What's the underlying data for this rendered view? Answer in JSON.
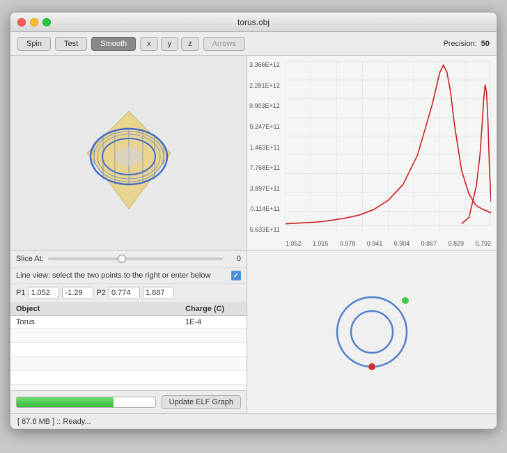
{
  "window": {
    "title": "torus.obj"
  },
  "toolbar": {
    "spin_label": "Spin",
    "test_label": "Test",
    "smooth_label": "Smooth",
    "x_label": "x",
    "y_label": "y",
    "z_label": "z",
    "arrows_label": "Arrows",
    "precision_label": "Precision:",
    "precision_value": "50"
  },
  "slice": {
    "label": "Slice At:",
    "value": "0"
  },
  "line_view": {
    "text": "Line view: select the two points to the right or enter below"
  },
  "points": {
    "p1_label": "P1",
    "p1_x": "1.052",
    "p1_y": "-1.29",
    "p2_label": "P2",
    "p2_x": "0.774",
    "p2_y": "1.687"
  },
  "table": {
    "headers": [
      "Object",
      "Charge (C)"
    ],
    "rows": [
      {
        "object": "Torus",
        "charge": "1E-4"
      }
    ]
  },
  "update_button": {
    "label": "Update ELF Graph"
  },
  "status": {
    "text": "[ 87.8 MB ] :: Ready..."
  },
  "chart": {
    "y_labels": [
      "3.366E+12",
      "2.281E+12",
      "9.903E+12",
      "5.247E+11",
      "1.463E+11",
      "7.768E+11",
      "3.897E+11",
      "0.114E+11",
      "5.633E+11"
    ],
    "x_labels": [
      "1.052",
      "1.015",
      "0.978",
      "0.941",
      "0.904",
      "0.867",
      "0.829",
      "0.792"
    ]
  }
}
